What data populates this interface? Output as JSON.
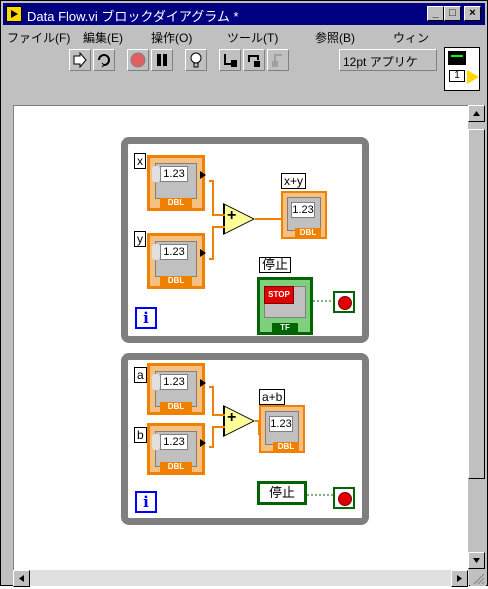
{
  "window": {
    "title": "Data Flow.vi ブロックダイアグラム *",
    "min_label": "_",
    "max_label": "□",
    "close_label": "×"
  },
  "menu": {
    "items": [
      {
        "label": "ファイル(F)"
      },
      {
        "label": "編集(E)"
      },
      {
        "label": "操作(O)"
      },
      {
        "label": "ツール(T)"
      },
      {
        "label": "参照(B)"
      },
      {
        "label": "ウィン"
      }
    ]
  },
  "toolbar": {
    "font": "12pt アプリケ",
    "conn_label": "1"
  },
  "loop1": {
    "x_label": "x",
    "y_label": "y",
    "sum_label": "x+y",
    "stop_label": "停止",
    "x_value": "1.23",
    "y_value": "1.23",
    "sum_value": "1.23",
    "dbl": "DBL",
    "stop_text": "STOP",
    "tf": "TF",
    "iter": "i",
    "plus": "+"
  },
  "loop2": {
    "a_label": "a",
    "b_label": "b",
    "sum_label": "a+b",
    "stop_label": "停止",
    "a_value": "1.23",
    "b_value": "1.23",
    "sum_value": "1.23",
    "dbl": "DBL",
    "iter": "i",
    "plus": "+"
  }
}
